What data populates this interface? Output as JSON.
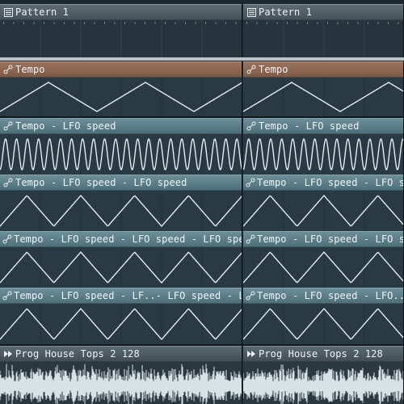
{
  "tracks": [
    {
      "kind": "pattern",
      "label": "Pattern 1",
      "icon": "pattern-icon",
      "accent": "#4f5c64"
    },
    {
      "kind": "tempo",
      "label": "Tempo",
      "icon": "automation-icon",
      "accent": "#8a6450"
    },
    {
      "kind": "lfo",
      "label": "Tempo - LFO speed",
      "icon": "automation-icon",
      "accent": "#5b7e88"
    },
    {
      "kind": "lfo",
      "label": "Tempo - LFO speed - LFO speed",
      "icon": "automation-icon",
      "accent": "#5b7e88"
    },
    {
      "kind": "lfo",
      "label": "Tempo - LFO speed - LFO speed - LFO speed",
      "icon": "automation-icon",
      "accent": "#5b7e88"
    },
    {
      "kind": "lfo",
      "label_left": "Tempo - LFO speed - LF..- LFO speed - LFO speed",
      "label_right": "Tempo - LFO speed - LFO..- LFO speed",
      "icon": "automation-icon",
      "accent": "#5b7e88"
    },
    {
      "kind": "audio",
      "label": "Prog House Tops 2 128",
      "icon": "audio-clip-icon",
      "accent": "#4a5860"
    }
  ],
  "waves": {
    "tempo_cycles_per_clip": 2.5,
    "lfo1_cycles_per_clip": 22,
    "lfo2_cycles_per_clip": 4.5,
    "lfo3_cycles_per_clip": 4.5,
    "lfo4_cycles_per_clip": 4.5
  }
}
